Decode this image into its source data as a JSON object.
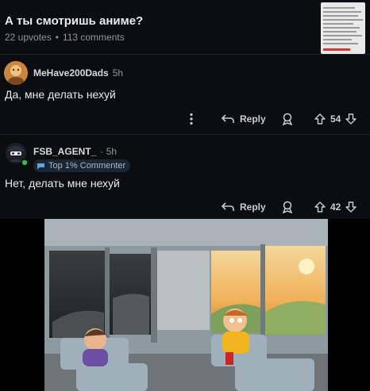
{
  "post": {
    "title": "А ты смотришь аниме?",
    "upvotes": "22 upvotes",
    "comments": "113 comments"
  },
  "comments": [
    {
      "author": "MeHave200Dads",
      "time": "5h",
      "text": "Да, мне делать нехуй",
      "reply_label": "Reply",
      "score": "54"
    },
    {
      "author": "FSB_AGENT_",
      "time": "· 5h",
      "badge": "Top 1% Commenter",
      "text": "Нет, делать мне нехуй",
      "reply_label": "Reply",
      "score": "42"
    }
  ],
  "image": {
    "icon": "bus-meme-illustration"
  },
  "colors": {
    "background": "#0b0d10",
    "text": "#e8eaed",
    "muted": "#8e969c",
    "badge_bg": "#1a2733",
    "online": "#2dbd4e"
  }
}
